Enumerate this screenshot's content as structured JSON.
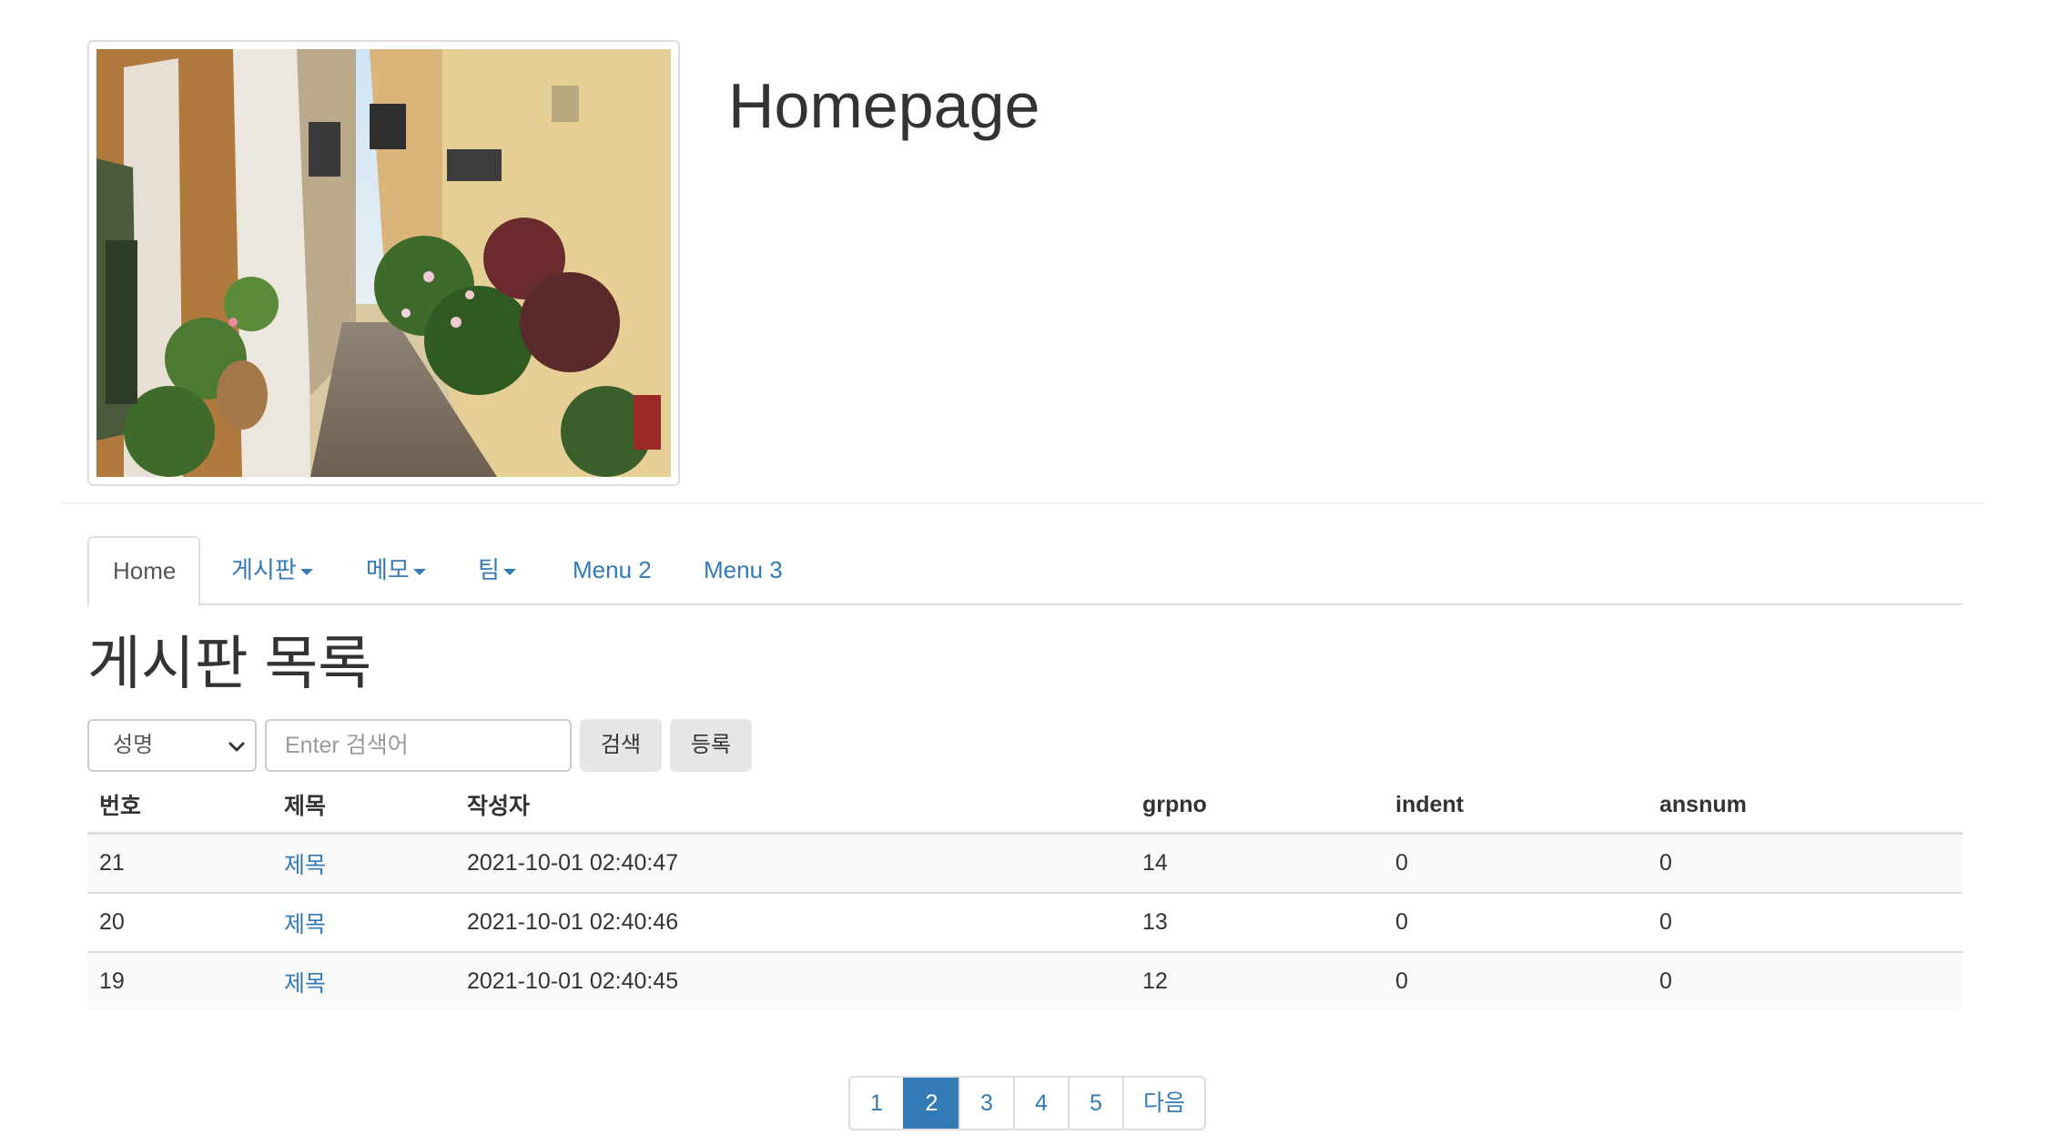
{
  "header": {
    "title": "Homepage",
    "image_alt": "street-photo"
  },
  "nav": {
    "items": [
      {
        "label": "Home",
        "active": true,
        "dropdown": false
      },
      {
        "label": "게시판",
        "active": false,
        "dropdown": true
      },
      {
        "label": "메모",
        "active": false,
        "dropdown": true
      },
      {
        "label": "팀",
        "active": false,
        "dropdown": true
      },
      {
        "label": "Menu 2",
        "active": false,
        "dropdown": false
      },
      {
        "label": "Menu 3",
        "active": false,
        "dropdown": false
      }
    ]
  },
  "board": {
    "heading": "게시판 목록",
    "search": {
      "field_selected": "성명",
      "placeholder": "Enter 검색어",
      "search_label": "검색",
      "register_label": "등록"
    },
    "columns": [
      "번호",
      "제목",
      "작성자",
      "grpno",
      "indent",
      "ansnum"
    ],
    "rows": [
      {
        "no": "21",
        "title": "제목",
        "writer": "2021-10-01 02:40:47",
        "grpno": "14",
        "indent": "0",
        "ansnum": "0"
      },
      {
        "no": "20",
        "title": "제목",
        "writer": "2021-10-01 02:40:46",
        "grpno": "13",
        "indent": "0",
        "ansnum": "0"
      },
      {
        "no": "19",
        "title": "제목",
        "writer": "2021-10-01 02:40:45",
        "grpno": "12",
        "indent": "0",
        "ansnum": "0"
      }
    ]
  },
  "pagination": {
    "pages": [
      "1",
      "2",
      "3",
      "4",
      "5"
    ],
    "current": "2",
    "next_label": "다음"
  },
  "colors": {
    "link": "#337ab7",
    "active_page_bg": "#337ab7",
    "border": "#dddddd",
    "stripe": "#f9f9f9"
  }
}
